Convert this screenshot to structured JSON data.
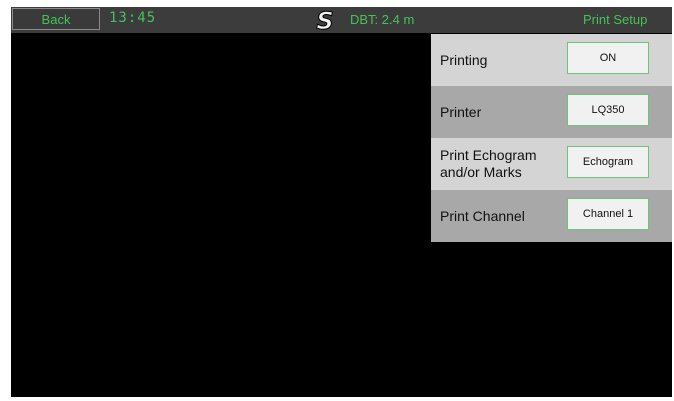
{
  "header": {
    "back_label": "Back",
    "time": "13:45",
    "dbt": "DBT: 2.4 m",
    "title": "Print Setup"
  },
  "settings": [
    {
      "label": "Printing",
      "value": "ON"
    },
    {
      "label": "Printer",
      "value": "LQ350"
    },
    {
      "label": "Print Echogram and/or Marks",
      "value": "Echogram"
    },
    {
      "label": "Print Channel",
      "value": "Channel 1"
    }
  ],
  "colors": {
    "accent": "#44c257",
    "background": "#000000",
    "row_light": "#d4d4d4",
    "row_dark": "#a8a8a8"
  },
  "icons": {
    "logo": "s-logo-icon"
  }
}
